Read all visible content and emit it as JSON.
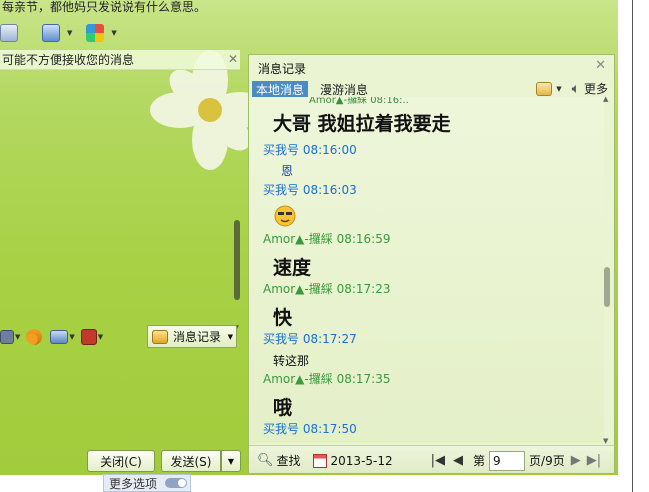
{
  "main": {
    "top_text": "每亲节，都他妈只发说说有什么意思。",
    "notice": "可能不方便接收您的消息",
    "history_button": "消息记录",
    "close_button": "关闭(C)",
    "send_button": "发送(S)",
    "more_options": "更多选项"
  },
  "history": {
    "title": "消息记录",
    "tabs": [
      {
        "label": "本地消息"
      },
      {
        "label": "漫游消息"
      }
    ],
    "more_label": "更多",
    "cut_top": "Amor▲-攞綵 08:16:..",
    "messages": [
      {
        "sender": "",
        "time": "",
        "text": "大哥 我姐拉着我要走",
        "style": "big"
      },
      {
        "sender": "买我号",
        "time": "08:16:00",
        "text": "恩",
        "style": "small-blue"
      },
      {
        "sender": "买我号",
        "time": "08:16:03",
        "text": "",
        "style": "emoji"
      },
      {
        "sender": "Amor▲-攞綵",
        "time": "08:16:59",
        "text": "速度",
        "style": "big"
      },
      {
        "sender": "Amor▲-攞綵",
        "time": "08:17:23",
        "text": "快",
        "style": "big"
      },
      {
        "sender": "买我号",
        "time": "08:17:27",
        "text": "转这那",
        "style": "small"
      },
      {
        "sender": "Amor▲-攞綵",
        "time": "08:17:35",
        "text": "哦",
        "style": "big"
      },
      {
        "sender": "买我号",
        "time": "08:17:50",
        "text": "",
        "style": "none"
      }
    ],
    "footer": {
      "search": "查找",
      "date": "2013-5-12",
      "page_prefix": "第",
      "page_value": "9",
      "page_suffix": "页/9页"
    }
  },
  "colors": {
    "accent_blue": "#4a8dc5",
    "sender_blue": "#1a6fd0",
    "sender_green": "#3a9a3a",
    "panel_bg": "#eaf3d2",
    "window_green": "#a8d145"
  }
}
